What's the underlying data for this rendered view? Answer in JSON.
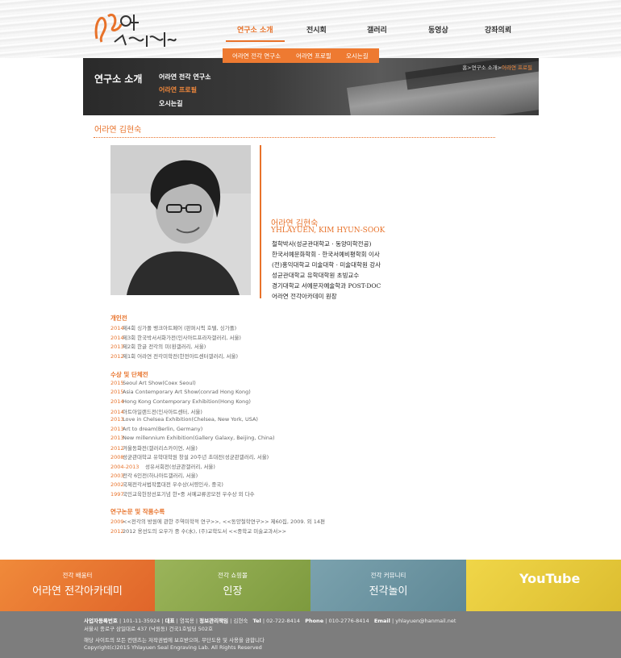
{
  "logo": {
    "alt": "어라연 전각연구소"
  },
  "gnb": {
    "items": [
      "연구소 소개",
      "전시회",
      "갤러리",
      "동영상",
      "강좌의뢰"
    ],
    "sub": [
      "어라연 전각 연구소",
      "어라연 프로필",
      "오시는길"
    ]
  },
  "banner": {
    "title": "연구소 소개",
    "side": [
      "어라연 전각 연구소",
      "어라연 프로필",
      "오시는길"
    ],
    "crumb": {
      "path": "홈>연구소 소개>",
      "current": "어라연 프로필"
    }
  },
  "section_title": "어라연 김현숙",
  "profile": {
    "name_ko": "어라연 김현숙",
    "name_en": "YHLAYUEN, KIM HYUN-SOOK",
    "bio": [
      "철학박사(성균관대학교 · 동양미학전공)",
      "한국서예문화학회 · 한국서예비평학회 이사",
      "(전)홍익대학교 미술대학 · 미술대학원 강사",
      "성균관대학교 유학대학원 초빙교수",
      "경기대학교 서예문자예술학과 POST-DOC",
      "어라연 전각아카데미 원장"
    ]
  },
  "solo": {
    "heading": "개인전",
    "rows": [
      {
        "year": "2014",
        "text": "제4회 싱가폴 뱅크아트페어 (판퍼시픽 호텔, 싱가폴)"
      },
      {
        "year": "2014",
        "text": "제3회 한국박서서화가전(인사아트프라자갤러리, 서울)"
      },
      {
        "year": "2013",
        "text": "제2회 한글 전각의 미(환갤러리, 서울)"
      },
      {
        "year": "2012",
        "text": "제1회 어라연 전각미학전(한전아트센터갤러리, 서울)"
      }
    ]
  },
  "awards": {
    "heading": "수상 및 단체전",
    "rows": [
      {
        "year": "2015",
        "text": "Seoul Art Show(Coex Seoul)"
      },
      {
        "year": "2015",
        "text": "Asia Contemporary Art Show(conrad Hong Kong)"
      },
      {
        "year": "2014",
        "text": "Hong Kong Contemporary Exhibition(Hong Kong)"
      },
      {
        "year": "2014",
        "text": "아트아일랜드전(인사아트센터, 서울)"
      },
      {
        "year": "2013",
        "text": "Love in Chelsea Exhibition(Chelsea, New York, USA)"
      },
      {
        "year": "2013",
        "text": "Art to dream(Berlin, Germany)"
      },
      {
        "year": "2013",
        "text": "New millennium Exhibition(Gallery Galaxy, Beijing, China)"
      },
      {
        "year": "2012",
        "text": "겨울동화전(갤러리스카이연, 서울)"
      },
      {
        "year": "2008",
        "text": "성균관대학교 유학대학원 창설 20주년 초대전(성균관갤러리, 서울)"
      },
      {
        "year": "2004-2013",
        "text": "성유서회전(성균관갤러리, 서울)"
      },
      {
        "year": "2003",
        "text": "전각 6인전(하나아트갤러리, 서울)"
      },
      {
        "year": "2002",
        "text": "국제전각서법작품대전 우수상(서령인사, 중국)"
      },
      {
        "year": "1997",
        "text": "국민교육헌장선포기념 한•중 서예교류공모전 우수상 외 다수"
      }
    ]
  },
  "papers": {
    "heading": "연구논문 및 작품수록",
    "rows": [
      {
        "year": "2009",
        "text": "<<전각의 방원에 관한 주역미학적 연구>>, <<동양철학연구>> 제60집, 2009. 외 14편"
      },
      {
        "year": "2012",
        "text": "2012 용선도의 오우가 중 수(水), (주)교학도서 <<중학교 미술교과서>>"
      }
    ]
  },
  "footer": {
    "bands": [
      {
        "label": "전각 배움터",
        "mark": "어라연 전각아카데미",
        "color": "#e8742f"
      },
      {
        "label": "전각 쇼핑몰",
        "mark": "인장",
        "color": "#8ba64a"
      },
      {
        "label": "전각 커뮤니티",
        "mark": "전각놀이",
        "color": "#6c94a2"
      },
      {
        "label": "",
        "mark": "YouTube",
        "color": "#e6c93c"
      }
    ],
    "info1": {
      "biz_label": "사업자등록번호",
      "biz": "101-11-35924",
      "ceo_label": "대표",
      "ceo": "염복용",
      "privacy_label": "정보관리책임",
      "privacy": "김현숙",
      "tel_label": "Tel",
      "tel": "02-722-8414",
      "phone_label": "Phone",
      "phone": "010-2776-8414",
      "email_label": "Email",
      "email": "yhlayuen@hanmail.net"
    },
    "address": "서울시 종로구 삼일대로 437 (낙원동) 건국1호빌딩 502호",
    "notice": "해당 사이트의 모든 컨텐츠는 저작권법에 보호받으며, 무단도용 및 사용을 금합니다",
    "copyright": "Copyright(c)2015 Yhlayuen Seal Engraving Lab. All Rights Reserved"
  }
}
